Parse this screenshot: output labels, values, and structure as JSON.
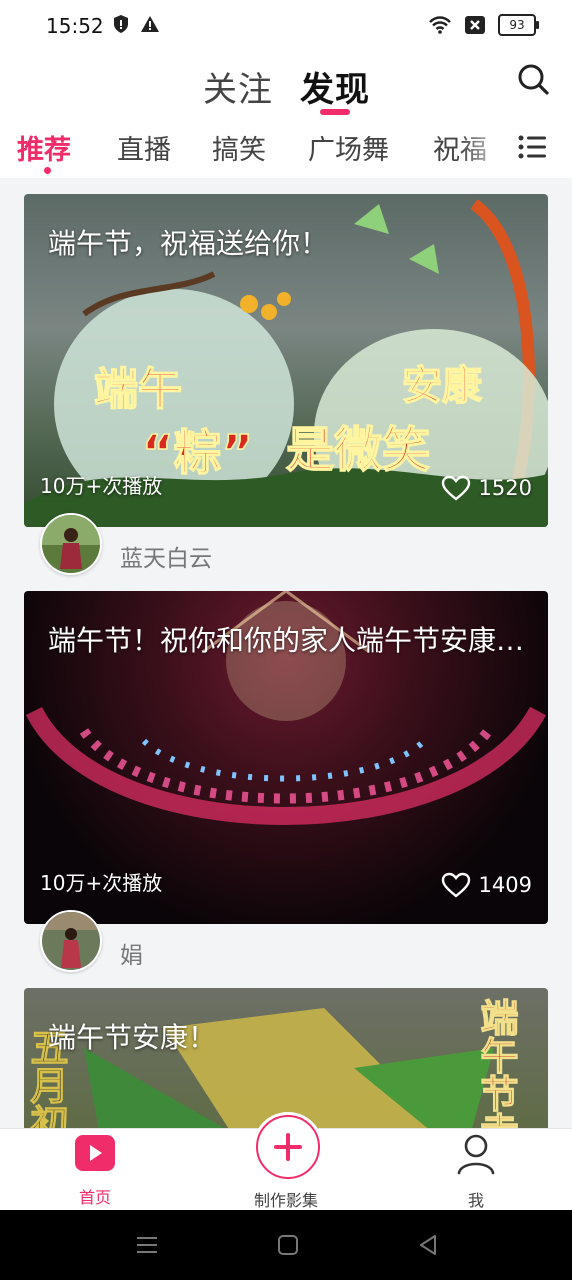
{
  "status": {
    "time": "15:52",
    "battery": "93"
  },
  "header": {
    "tabs": [
      {
        "label": "关注"
      },
      {
        "label": "发现"
      }
    ]
  },
  "categories": [
    "推荐",
    "直播",
    "搞笑",
    "广场舞",
    "祝福"
  ],
  "feed": [
    {
      "title": "端午节，祝福送给你！",
      "plays": "10万+次播放",
      "likes": "1520",
      "author": "蓝天白云"
    },
    {
      "title": "端午节！祝你和你的家人端午节安康…",
      "plays": "10万+次播放",
      "likes": "1409",
      "author": "娟"
    },
    {
      "title": "端午节安康！"
    }
  ],
  "thumb1_text": {
    "left1": "端午",
    "right1": "安康",
    "quote": "“粽”",
    "center": "是微笑"
  },
  "thumb3_text": {
    "left": "五月初五",
    "right": "端午节幸"
  },
  "bottom_nav": [
    {
      "label": "首页"
    },
    {
      "label": "制作影集"
    },
    {
      "label": "我"
    }
  ],
  "colors": {
    "accent": "#f02d6a"
  }
}
